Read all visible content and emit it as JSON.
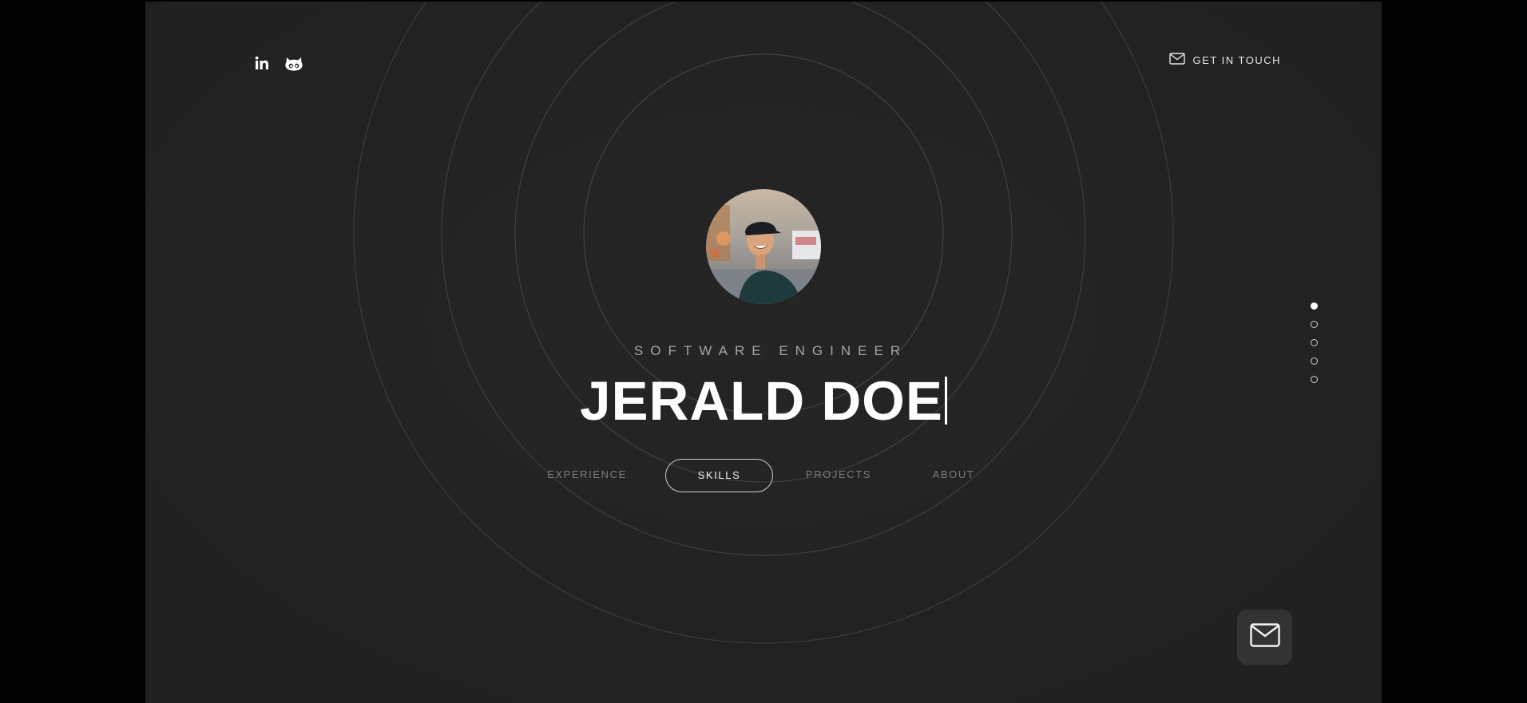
{
  "header": {
    "socials": [
      {
        "icon": "linkedin-icon"
      },
      {
        "icon": "github-icon"
      }
    ],
    "contact_link": {
      "icon": "mail-icon",
      "label": "GET IN TOUCH"
    }
  },
  "hero": {
    "avatar": "profile-photo",
    "subtitle": "SOFTWARE ENGINEER",
    "name": "JERALD DOE"
  },
  "nav": {
    "tabs": [
      {
        "label": "EXPERIENCE",
        "active": false
      },
      {
        "label": "SKILLS",
        "active": true
      },
      {
        "label": "PROJECTS",
        "active": false
      },
      {
        "label": "ABOUT",
        "active": false
      }
    ]
  },
  "section_dots": {
    "count": 5,
    "active_index": 0
  },
  "fab": {
    "icon": "mail-icon"
  },
  "colors": {
    "background": "#232323",
    "outer_background": "#000000",
    "text_primary": "#ffffff",
    "text_muted": "#7c7c7c",
    "ring_stroke": "#4a4a4a"
  }
}
